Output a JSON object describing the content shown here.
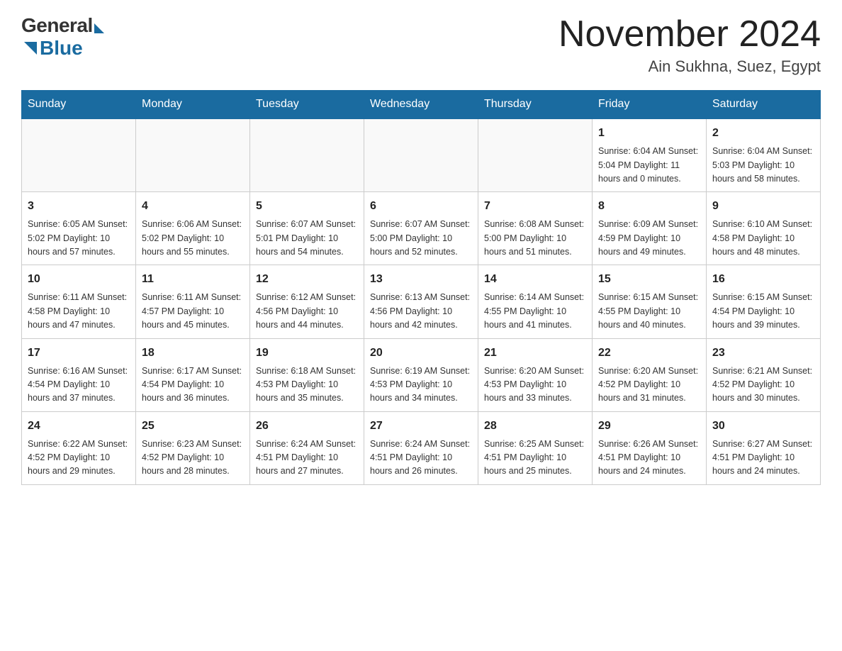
{
  "logo": {
    "general": "General",
    "blue": "Blue"
  },
  "title": "November 2024",
  "subtitle": "Ain Sukhna, Suez, Egypt",
  "days_of_week": [
    "Sunday",
    "Monday",
    "Tuesday",
    "Wednesday",
    "Thursday",
    "Friday",
    "Saturday"
  ],
  "weeks": [
    [
      {
        "day": "",
        "info": ""
      },
      {
        "day": "",
        "info": ""
      },
      {
        "day": "",
        "info": ""
      },
      {
        "day": "",
        "info": ""
      },
      {
        "day": "",
        "info": ""
      },
      {
        "day": "1",
        "info": "Sunrise: 6:04 AM\nSunset: 5:04 PM\nDaylight: 11 hours and 0 minutes."
      },
      {
        "day": "2",
        "info": "Sunrise: 6:04 AM\nSunset: 5:03 PM\nDaylight: 10 hours and 58 minutes."
      }
    ],
    [
      {
        "day": "3",
        "info": "Sunrise: 6:05 AM\nSunset: 5:02 PM\nDaylight: 10 hours and 57 minutes."
      },
      {
        "day": "4",
        "info": "Sunrise: 6:06 AM\nSunset: 5:02 PM\nDaylight: 10 hours and 55 minutes."
      },
      {
        "day": "5",
        "info": "Sunrise: 6:07 AM\nSunset: 5:01 PM\nDaylight: 10 hours and 54 minutes."
      },
      {
        "day": "6",
        "info": "Sunrise: 6:07 AM\nSunset: 5:00 PM\nDaylight: 10 hours and 52 minutes."
      },
      {
        "day": "7",
        "info": "Sunrise: 6:08 AM\nSunset: 5:00 PM\nDaylight: 10 hours and 51 minutes."
      },
      {
        "day": "8",
        "info": "Sunrise: 6:09 AM\nSunset: 4:59 PM\nDaylight: 10 hours and 49 minutes."
      },
      {
        "day": "9",
        "info": "Sunrise: 6:10 AM\nSunset: 4:58 PM\nDaylight: 10 hours and 48 minutes."
      }
    ],
    [
      {
        "day": "10",
        "info": "Sunrise: 6:11 AM\nSunset: 4:58 PM\nDaylight: 10 hours and 47 minutes."
      },
      {
        "day": "11",
        "info": "Sunrise: 6:11 AM\nSunset: 4:57 PM\nDaylight: 10 hours and 45 minutes."
      },
      {
        "day": "12",
        "info": "Sunrise: 6:12 AM\nSunset: 4:56 PM\nDaylight: 10 hours and 44 minutes."
      },
      {
        "day": "13",
        "info": "Sunrise: 6:13 AM\nSunset: 4:56 PM\nDaylight: 10 hours and 42 minutes."
      },
      {
        "day": "14",
        "info": "Sunrise: 6:14 AM\nSunset: 4:55 PM\nDaylight: 10 hours and 41 minutes."
      },
      {
        "day": "15",
        "info": "Sunrise: 6:15 AM\nSunset: 4:55 PM\nDaylight: 10 hours and 40 minutes."
      },
      {
        "day": "16",
        "info": "Sunrise: 6:15 AM\nSunset: 4:54 PM\nDaylight: 10 hours and 39 minutes."
      }
    ],
    [
      {
        "day": "17",
        "info": "Sunrise: 6:16 AM\nSunset: 4:54 PM\nDaylight: 10 hours and 37 minutes."
      },
      {
        "day": "18",
        "info": "Sunrise: 6:17 AM\nSunset: 4:54 PM\nDaylight: 10 hours and 36 minutes."
      },
      {
        "day": "19",
        "info": "Sunrise: 6:18 AM\nSunset: 4:53 PM\nDaylight: 10 hours and 35 minutes."
      },
      {
        "day": "20",
        "info": "Sunrise: 6:19 AM\nSunset: 4:53 PM\nDaylight: 10 hours and 34 minutes."
      },
      {
        "day": "21",
        "info": "Sunrise: 6:20 AM\nSunset: 4:53 PM\nDaylight: 10 hours and 33 minutes."
      },
      {
        "day": "22",
        "info": "Sunrise: 6:20 AM\nSunset: 4:52 PM\nDaylight: 10 hours and 31 minutes."
      },
      {
        "day": "23",
        "info": "Sunrise: 6:21 AM\nSunset: 4:52 PM\nDaylight: 10 hours and 30 minutes."
      }
    ],
    [
      {
        "day": "24",
        "info": "Sunrise: 6:22 AM\nSunset: 4:52 PM\nDaylight: 10 hours and 29 minutes."
      },
      {
        "day": "25",
        "info": "Sunrise: 6:23 AM\nSunset: 4:52 PM\nDaylight: 10 hours and 28 minutes."
      },
      {
        "day": "26",
        "info": "Sunrise: 6:24 AM\nSunset: 4:51 PM\nDaylight: 10 hours and 27 minutes."
      },
      {
        "day": "27",
        "info": "Sunrise: 6:24 AM\nSunset: 4:51 PM\nDaylight: 10 hours and 26 minutes."
      },
      {
        "day": "28",
        "info": "Sunrise: 6:25 AM\nSunset: 4:51 PM\nDaylight: 10 hours and 25 minutes."
      },
      {
        "day": "29",
        "info": "Sunrise: 6:26 AM\nSunset: 4:51 PM\nDaylight: 10 hours and 24 minutes."
      },
      {
        "day": "30",
        "info": "Sunrise: 6:27 AM\nSunset: 4:51 PM\nDaylight: 10 hours and 24 minutes."
      }
    ]
  ]
}
